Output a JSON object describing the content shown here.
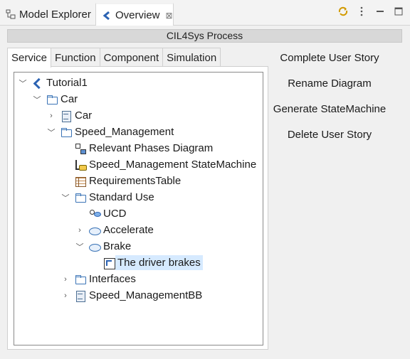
{
  "view_tabs": [
    {
      "label": "Model Explorer",
      "icon": "model-explorer-icon"
    },
    {
      "label": "Overview",
      "icon": "capella-icon",
      "close": "⊠"
    }
  ],
  "view_buttons": [
    "sync-icon",
    "view-menu-icon",
    "minimize-icon",
    "maximize-icon"
  ],
  "process_title": "CIL4Sys Process",
  "tabs": [
    "Service",
    "Function",
    "Component",
    "Simulation"
  ],
  "active_tab": "Service",
  "tree": [
    {
      "label": "Tutorial1",
      "icon": "capella-model-icon",
      "expanded": true
    },
    {
      "label": "Car",
      "icon": "folder-icon",
      "expanded": true
    },
    {
      "label": "Car",
      "icon": "block-icon",
      "expanded": false
    },
    {
      "label": "Speed_Management",
      "icon": "folder-icon",
      "expanded": true
    },
    {
      "label": "Relevant Phases Diagram",
      "icon": "diagram-icon"
    },
    {
      "label": "Speed_Management StateMachine",
      "icon": "state-machine-icon"
    },
    {
      "label": "RequirementsTable",
      "icon": "table-icon"
    },
    {
      "label": "Standard Use",
      "icon": "folder-icon",
      "expanded": true
    },
    {
      "label": "UCD",
      "icon": "use-case-diagram-icon"
    },
    {
      "label": "Accelerate",
      "icon": "use-case-icon",
      "expanded": false
    },
    {
      "label": "Brake",
      "icon": "use-case-icon",
      "expanded": true
    },
    {
      "label": "The driver brakes",
      "icon": "scenario-icon",
      "selected": true
    },
    {
      "label": "Interfaces",
      "icon": "folder-icon",
      "expanded": false
    },
    {
      "label": "Speed_ManagementBB",
      "icon": "block-icon",
      "expanded": false
    }
  ],
  "actions": [
    "Complete User Story",
    "Rename Diagram",
    "Generate StateMachine",
    "Delete User Story"
  ],
  "colors": {
    "selection": "#d6eaff",
    "accent": "#2c63b3"
  }
}
